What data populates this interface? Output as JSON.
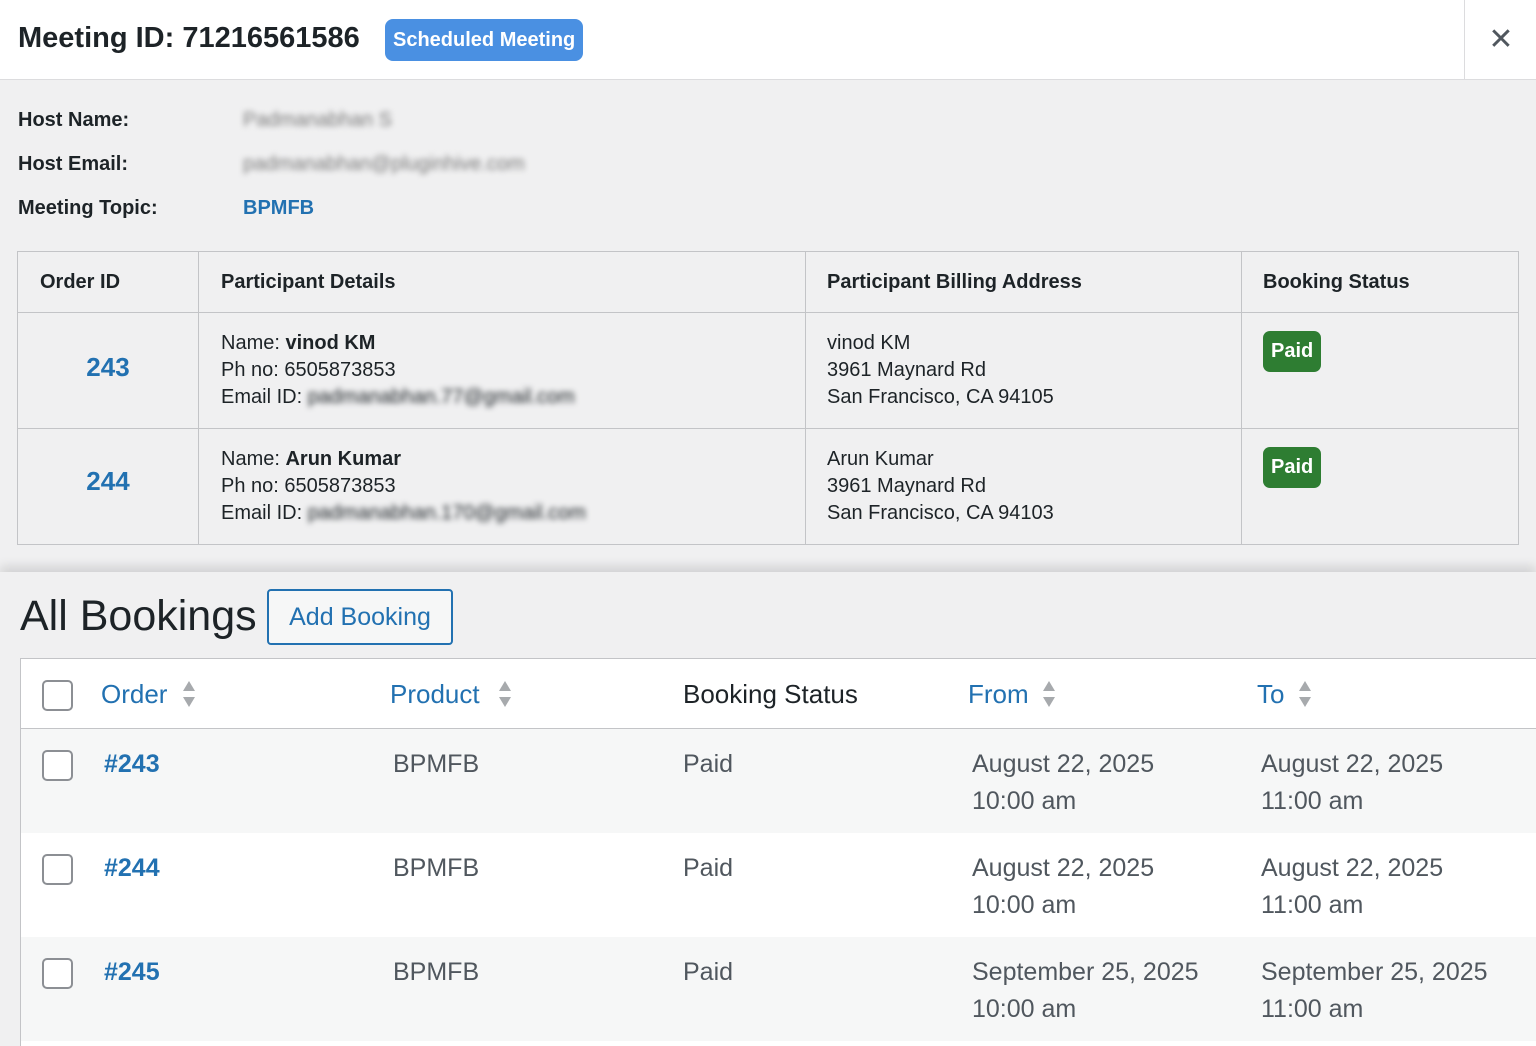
{
  "modal": {
    "title": "Meeting ID: 71216561586",
    "badge": "Scheduled Meeting",
    "close_glyph": "✕",
    "info": {
      "host_name_label": "Host Name:",
      "host_name_value": "Padmanabhan S",
      "host_email_label": "Host Email:",
      "host_email_value": "padmanabhan@pluginhive.com",
      "topic_label": "Meeting Topic:",
      "topic_value": "BPMFB"
    },
    "participants": {
      "headers": [
        "Order ID",
        "Participant Details",
        "Participant Billing Address",
        "Booking Status"
      ],
      "rows": [
        {
          "order_id": "243",
          "name_label": "Name:",
          "name": "vinod KM",
          "phone_label": "Ph no:",
          "phone": "6505873853",
          "email_label": "Email ID:",
          "email": "padmanabhan.77@gmail.com",
          "address": [
            "vinod KM",
            "3961 Maynard Rd",
            "San Francisco, CA 94105"
          ],
          "status": "Paid"
        },
        {
          "order_id": "244",
          "name_label": "Name:",
          "name": "Arun Kumar",
          "phone_label": "Ph no:",
          "phone": "6505873853",
          "email_label": "Email ID:",
          "email": "padmanabhan.170@gmail.com",
          "address": [
            "Arun Kumar",
            "3961 Maynard Rd",
            "San Francisco, CA 94103"
          ],
          "status": "Paid"
        }
      ]
    }
  },
  "bookings": {
    "title": "All Bookings",
    "add_label": "Add Booking",
    "columns": {
      "order": "Order",
      "product": "Product",
      "status": "Booking Status",
      "from": "From",
      "to": "To"
    },
    "rows": [
      {
        "order": "#243",
        "product": "BPMFB",
        "status": "Paid",
        "from_date": "August 22, 2025",
        "from_time": "10:00 am",
        "to_date": "August 22, 2025",
        "to_time": "11:00 am"
      },
      {
        "order": "#244",
        "product": "BPMFB",
        "status": "Paid",
        "from_date": "August 22, 2025",
        "from_time": "10:00 am",
        "to_date": "August 22, 2025",
        "to_time": "11:00 am"
      },
      {
        "order": "#245",
        "product": "BPMFB",
        "status": "Paid",
        "from_date": "September 25, 2025",
        "from_time": "10:00 am",
        "to_date": "September 25, 2025",
        "to_time": "11:00 am"
      }
    ]
  },
  "colors": {
    "link": "#2271b1",
    "badge_blue": "#4a90e2",
    "paid_green": "#2e7d32",
    "background": "#f0f0f1"
  },
  "icons": [
    "close-icon",
    "sort-icon",
    "checkbox"
  ]
}
